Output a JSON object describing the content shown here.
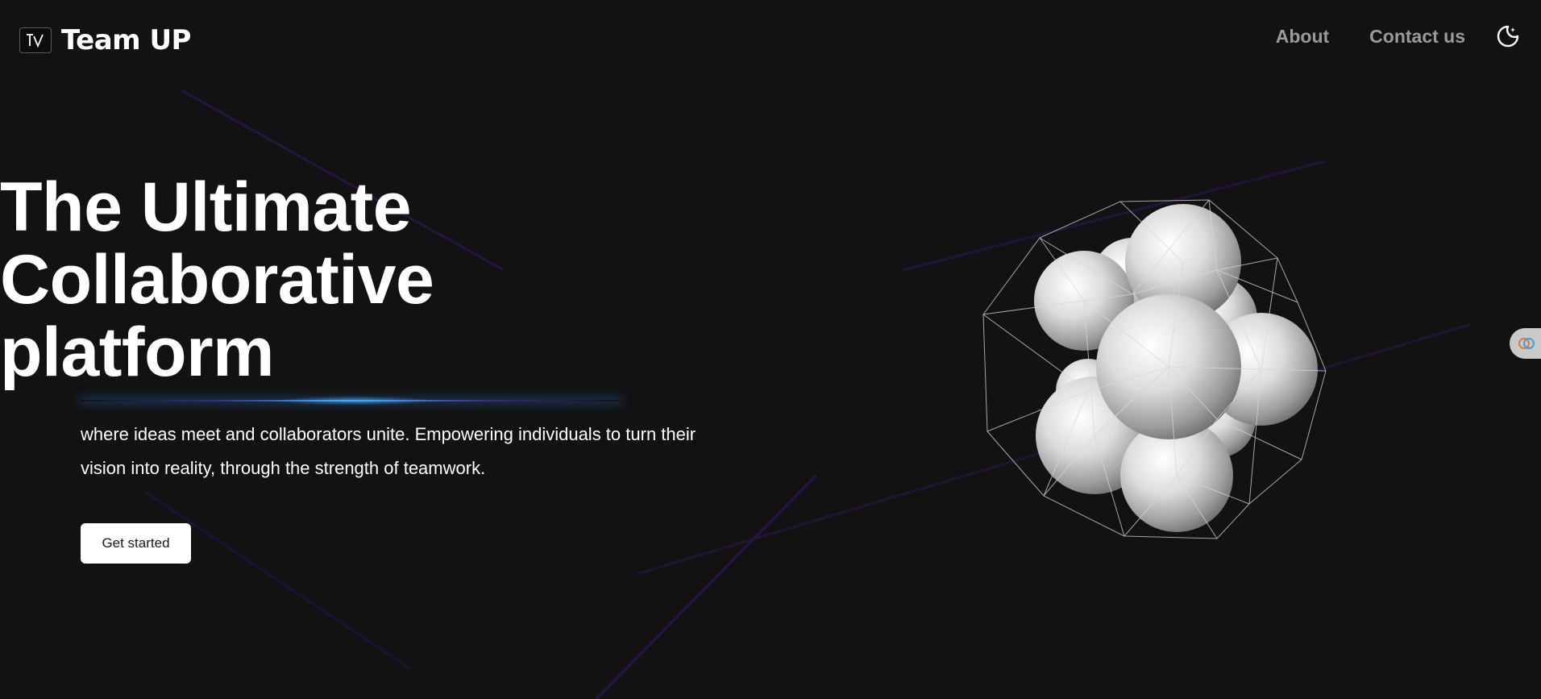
{
  "brand": {
    "name": "Team UP"
  },
  "nav": {
    "links": [
      {
        "label": "About"
      },
      {
        "label": "Contact us"
      }
    ],
    "theme_icon": "moon-icon"
  },
  "hero": {
    "title_lines": [
      "The Ultimate",
      "Collaborative",
      "platform"
    ],
    "description": "where ideas meet and collaborators unite. Empowering individuals to turn their vision into reality, through the strength of teamwork.",
    "cta_label": "Get started"
  },
  "colors": {
    "background": "#121212",
    "text": "#ffffff",
    "nav_text": "#9a9a9a",
    "glow_accent": "#3fa8ff",
    "line_accent": "#3a1a5e"
  },
  "icons": {
    "logo": "team-up-logo-icon",
    "theme": "moon-icon",
    "side_widget": "floating-widget-icon"
  }
}
